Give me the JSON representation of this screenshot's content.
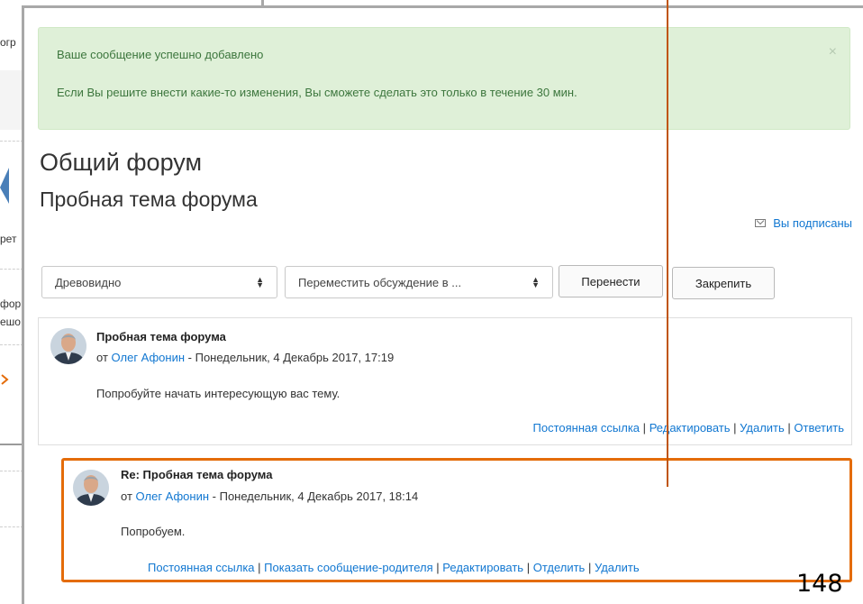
{
  "sidebar": {
    "frag1": "огр",
    "frag2": "рет",
    "frag3": "фор",
    "frag4": "ешо"
  },
  "alert": {
    "line1": "Ваше сообщение успешно добавлено",
    "line2": "Если Вы решите внести какие-то изменения, Вы сможете сделать это только в течение 30 мин.",
    "close": "×"
  },
  "headings": {
    "forum": "Общий форум",
    "topic": "Пробная тема форума"
  },
  "subscription": {
    "label": "Вы подписаны",
    "icon": "envelope-icon"
  },
  "controls": {
    "display_mode": "Древовидно",
    "move_select": "Переместить обсуждение в ...",
    "move_button": "Перенести",
    "pin_button": "Закрепить"
  },
  "post": {
    "subject": "Пробная тема форума",
    "by_prefix": "от",
    "author": "Олег Афонин",
    "date": "- Понедельник, 4 Декабрь 2017, 17:19",
    "message": "Попробуйте начать интересующую вас тему.",
    "commands": [
      "Постоянная ссылка",
      "Редактировать",
      "Удалить",
      "Ответить"
    ]
  },
  "reply": {
    "subject": "Re: Пробная тема форума",
    "by_prefix": "от",
    "author": "Олег Афонин",
    "date": "- Понедельник, 4 Декабрь 2017, 18:14",
    "message": "Попробуем.",
    "commands": [
      "Постоянная ссылка",
      "Показать сообщение-родителя",
      "Редактировать",
      "Отделить",
      "Удалить"
    ]
  },
  "separator": "|",
  "page_number": "148",
  "colors": {
    "alert_bg": "#dff0d8",
    "alert_text": "#3c763d",
    "link": "#1177d1",
    "highlight": "#e46c0a"
  }
}
